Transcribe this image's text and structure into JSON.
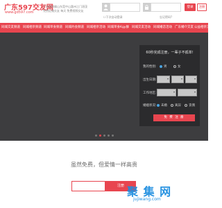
{
  "header": {
    "logo_title": "广东597交友网",
    "logo_url": "www.gd597.com",
    "tagline": [
      "广州深圳佛山东莞中山惠州江门湛茂",
      "免费征婚交友 每天 免费视频交友"
    ],
    "remember_label": "☐下次自动登录",
    "forgot_label": "忘记密码?",
    "login_label": "登录",
    "register_label": "注册"
  },
  "nav": {
    "items": [
      "同城交友频道",
      "同城相亲频道",
      "同城单身频道",
      "同城约会频道",
      "同城相亲活动",
      "同城单身Kgy群",
      "同城交友活动",
      "同城婚恋活动",
      "广东婚介交友",
      "公益相亲活动"
    ]
  },
  "banner": {
    "dots": 5,
    "active_dot": 1
  },
  "signup": {
    "title": "60秒完成注册，一辈子不孤单!",
    "gender_label": "我的性别:",
    "gender_options": [
      "男",
      "女"
    ],
    "gender_selected": 0,
    "birth_label": "出生日期:",
    "income_label": "工作地区:",
    "marital_label": "婚姻状况:",
    "marital_options": [
      "未婚",
      "离异",
      "丧偶"
    ],
    "marital_selected": 0,
    "submit_label": "免 费 注 册"
  },
  "lower": {
    "slogan": "虽然免费，但爱情一样高贵",
    "cta_label": "注册"
  },
  "watermark": {
    "text": "聚 集 网",
    "url": "jujiwang.com"
  },
  "colors": {
    "brand": "#e8454f",
    "banner_bg": "#3d3d3f",
    "panel_bg": "#2b2b2d",
    "watermark": "#1e8ee0"
  }
}
